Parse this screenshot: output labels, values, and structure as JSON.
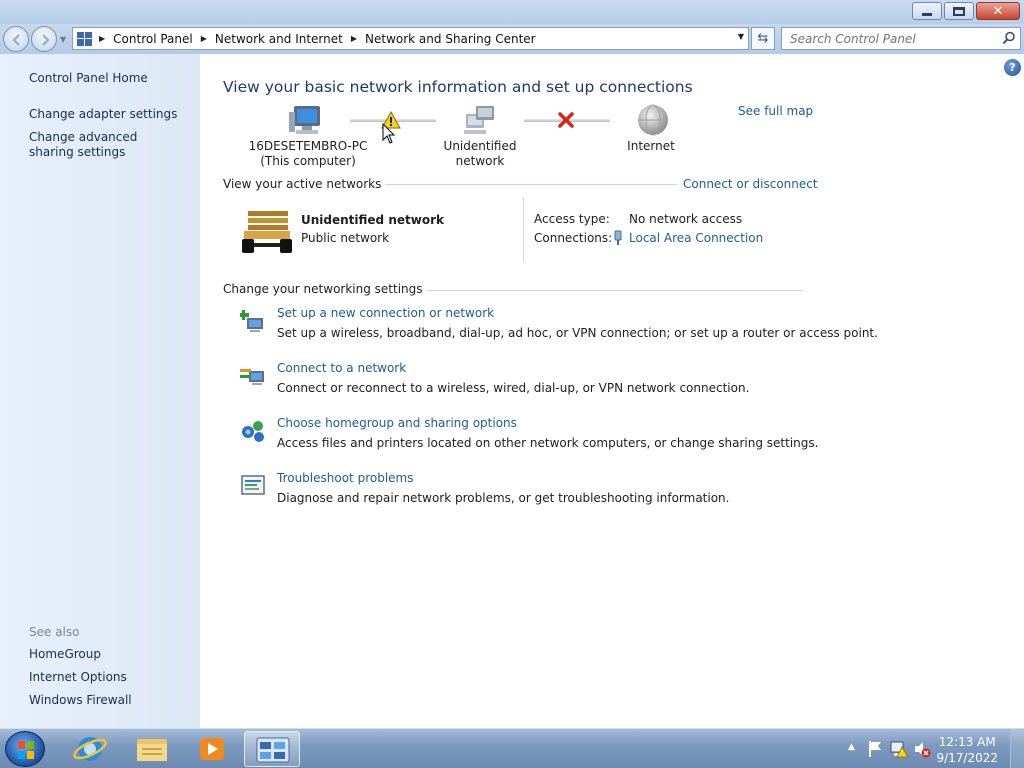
{
  "window": {
    "caption_buttons": [
      "minimize",
      "maximize",
      "close"
    ]
  },
  "navbar": {
    "breadcrumbs": [
      "Control Panel",
      "Network and Internet",
      "Network and Sharing Center"
    ],
    "search_placeholder": "Search Control Panel"
  },
  "sidebar": {
    "home": "Control Panel Home",
    "links": [
      "Change adapter settings",
      "Change advanced sharing settings"
    ],
    "see_also_heading": "See also",
    "see_also": [
      "HomeGroup",
      "Internet Options",
      "Windows Firewall"
    ]
  },
  "main": {
    "title": "View your basic network information and set up connections",
    "see_full_map": "See full map",
    "map_nodes": {
      "computer_name": "16DESETEMBRO-PC",
      "computer_sub": "(This computer)",
      "network": "Unidentified network",
      "internet": "Internet"
    },
    "active_networks": {
      "heading": "View your active networks",
      "connect_link": "Connect or disconnect",
      "network_name": "Unidentified network",
      "network_type": "Public network",
      "access_type_label": "Access type:",
      "access_type_value": "No network access",
      "connections_label": "Connections:",
      "connections_value": "Local Area Connection"
    },
    "settings": {
      "heading": "Change your networking settings",
      "tasks": [
        {
          "link": "Set up a new connection or network",
          "desc": "Set up a wireless, broadband, dial-up, ad hoc, or VPN connection; or set up a router or access point."
        },
        {
          "link": "Connect to a network",
          "desc": "Connect or reconnect to a wireless, wired, dial-up, or VPN network connection."
        },
        {
          "link": "Choose homegroup and sharing options",
          "desc": "Access files and printers located on other network computers, or change sharing settings."
        },
        {
          "link": "Troubleshoot problems",
          "desc": "Diagnose and repair network problems, or get troubleshooting information."
        }
      ]
    }
  },
  "taskbar": {
    "time": "12:13 AM",
    "date": "9/17/2022"
  },
  "colors": {
    "link": "#1f5b9a",
    "title": "#1e3a6e",
    "warning": "#f2d21b",
    "error": "#d8251c"
  }
}
